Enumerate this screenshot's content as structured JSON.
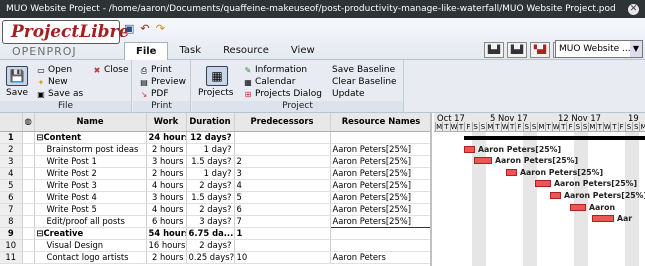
{
  "window": {
    "title": "MUO Website Project - /home/aaron/Documents/quaffeine-makeuseof/post-productivity-manage-like-waterfall/MUO Website Project.pod *"
  },
  "logo": {
    "main": "ProjectLibre",
    "sub": "OPENPROJ"
  },
  "tabs": [
    "File",
    "Task",
    "Resource",
    "View"
  ],
  "project_select": "MUO Website ...",
  "ribbon": {
    "file": {
      "label": "File",
      "save": "Save",
      "open": "Open",
      "close": "Close",
      "new": "New",
      "save_as": "Save as"
    },
    "print": {
      "label": "Print",
      "print": "Print",
      "preview": "Preview",
      "pdf": "PDF"
    },
    "project": {
      "label": "Project",
      "projects": "Projects",
      "information": "Information",
      "calendar": "Calendar",
      "projects_dialog": "Projects Dialog",
      "save_baseline": "Save Baseline",
      "clear_baseline": "Clear Baseline",
      "update": "Update"
    }
  },
  "table": {
    "columns": [
      "Name",
      "Work",
      "Duration",
      "Predecessors",
      "Resource Names"
    ],
    "rows": [
      {
        "n": "1",
        "name": "Content",
        "work": "24 hours",
        "duration": "12 days?",
        "pred": "",
        "res": "",
        "summary": true
      },
      {
        "n": "2",
        "name": "Brainstorm post ideas",
        "work": "2 hours",
        "duration": "1 day?",
        "pred": "",
        "res": "Aaron Peters[25%]"
      },
      {
        "n": "3",
        "name": "Write Post 1",
        "work": "3 hours",
        "duration": "1.5 days?",
        "pred": "2",
        "res": "Aaron Peters[25%]"
      },
      {
        "n": "4",
        "name": "Write Post 2",
        "work": "2 hours",
        "duration": "1 day?",
        "pred": "3",
        "res": "Aaron Peters[25%]"
      },
      {
        "n": "5",
        "name": "Write Post 3",
        "work": "4 hours",
        "duration": "2 days?",
        "pred": "4",
        "res": "Aaron Peters[25%]"
      },
      {
        "n": "6",
        "name": "Write Post 4",
        "work": "3 hours",
        "duration": "1.5 days?",
        "pred": "5",
        "res": "Aaron Peters[25%]"
      },
      {
        "n": "7",
        "name": "Write Post 5",
        "work": "4 hours",
        "duration": "2 days?",
        "pred": "6",
        "res": "Aaron Peters[25%]"
      },
      {
        "n": "8",
        "name": "Edit/proof all posts",
        "work": "6 hours",
        "duration": "3 days?",
        "pred": "7",
        "res": "Aaron Peters[25%]"
      },
      {
        "n": "9",
        "name": "Creative",
        "work": "54 hours",
        "duration": "6.75 da...",
        "pred": "1",
        "res": "",
        "summary": true
      },
      {
        "n": "10",
        "name": "Visual Design",
        "work": "16 hours",
        "duration": "2 days?",
        "pred": "",
        "res": ""
      },
      {
        "n": "11",
        "name": "Contact logo artists",
        "work": "2 hours",
        "duration": "0.25 days?",
        "pred": "10",
        "res": "Aaron Peters"
      }
    ]
  },
  "gantt": {
    "weeks": [
      "Oct 17",
      "5 Nov 17",
      "12 Nov 17",
      "19"
    ],
    "days": [
      "M",
      "T",
      "W",
      "T",
      "F",
      "S",
      "S",
      "M",
      "T",
      "W",
      "T",
      "F",
      "S",
      "S",
      "M",
      "T",
      "W",
      "T",
      "F",
      "S",
      "S",
      "M",
      "T",
      "W",
      "T",
      "F",
      "S",
      "S",
      "M"
    ],
    "labels": [
      "Aaron Peters[25%]",
      "Aaron Peters[25%]",
      "Aaron Peters[25%]",
      "Aaron Peters[25%]",
      "Aaron Peters[25%]",
      "Aaron",
      "Aar"
    ]
  }
}
